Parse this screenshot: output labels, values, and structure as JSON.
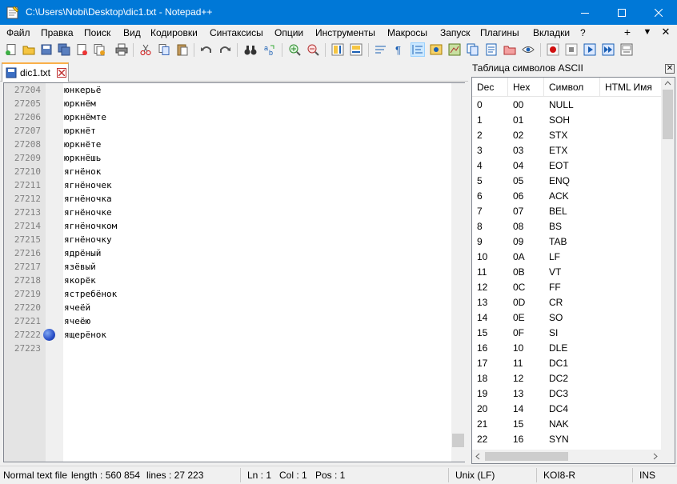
{
  "window": {
    "title": "C:\\Users\\Nobi\\Desktop\\dic1.txt - Notepad++"
  },
  "menu": [
    "Файл",
    "Правка",
    "Поиск",
    "Вид",
    "Кодировки",
    "Синтаксисы",
    "Опции",
    "Инструменты",
    "Макросы",
    "Запуск",
    "Плагины",
    "Вкладки",
    "?"
  ],
  "menu_right": [
    "+",
    "▼",
    "✕"
  ],
  "tab": {
    "label": "dic1.txt"
  },
  "editor": {
    "lines": [
      {
        "num": "27204",
        "text": "юнкерьё"
      },
      {
        "num": "27205",
        "text": "юркнём"
      },
      {
        "num": "27206",
        "text": "юркнёмте"
      },
      {
        "num": "27207",
        "text": "юркнёт"
      },
      {
        "num": "27208",
        "text": "юркнёте"
      },
      {
        "num": "27209",
        "text": "юркнёшь"
      },
      {
        "num": "27210",
        "text": "ягнёнок"
      },
      {
        "num": "27211",
        "text": "ягнёночек"
      },
      {
        "num": "27212",
        "text": "ягнёночка"
      },
      {
        "num": "27213",
        "text": "ягнёночке"
      },
      {
        "num": "27214",
        "text": "ягнёночком"
      },
      {
        "num": "27215",
        "text": "ягнёночку"
      },
      {
        "num": "27216",
        "text": "ядрёный"
      },
      {
        "num": "27217",
        "text": "язёвый"
      },
      {
        "num": "27218",
        "text": "якорёк"
      },
      {
        "num": "27219",
        "text": "ястребёнок"
      },
      {
        "num": "27220",
        "text": "ячеёй"
      },
      {
        "num": "27221",
        "text": "ячеёю"
      },
      {
        "num": "27222",
        "text": "ящерёнок"
      },
      {
        "num": "27223",
        "text": ""
      }
    ],
    "bookmark_line": "27222"
  },
  "ascii_panel": {
    "title": "Таблица символов ASCII",
    "columns": [
      "Dec",
      "Hex",
      "Символ",
      "HTML Имя"
    ],
    "rows": [
      [
        "0",
        "00",
        "NULL"
      ],
      [
        "1",
        "01",
        "SOH"
      ],
      [
        "2",
        "02",
        "STX"
      ],
      [
        "3",
        "03",
        "ETX"
      ],
      [
        "4",
        "04",
        "EOT"
      ],
      [
        "5",
        "05",
        "ENQ"
      ],
      [
        "6",
        "06",
        "ACK"
      ],
      [
        "7",
        "07",
        "BEL"
      ],
      [
        "8",
        "08",
        "BS"
      ],
      [
        "9",
        "09",
        "TAB"
      ],
      [
        "10",
        "0A",
        "LF"
      ],
      [
        "11",
        "0B",
        "VT"
      ],
      [
        "12",
        "0C",
        "FF"
      ],
      [
        "13",
        "0D",
        "CR"
      ],
      [
        "14",
        "0E",
        "SO"
      ],
      [
        "15",
        "0F",
        "SI"
      ],
      [
        "16",
        "10",
        "DLE"
      ],
      [
        "17",
        "11",
        "DC1"
      ],
      [
        "18",
        "12",
        "DC2"
      ],
      [
        "19",
        "13",
        "DC3"
      ],
      [
        "20",
        "14",
        "DC4"
      ],
      [
        "21",
        "15",
        "NAK"
      ],
      [
        "22",
        "16",
        "SYN"
      ]
    ]
  },
  "status": {
    "file_type": "Normal text file",
    "length": "length : 560 854",
    "lines": "lines : 27 223",
    "ln": "Ln : 1",
    "col": "Col : 1",
    "pos": "Pos : 1",
    "eol": "Unix (LF)",
    "encoding": "KOI8-R",
    "mode": "INS"
  },
  "colors": {
    "titlebar": "#0078d7",
    "tab_accent": "#fab04a",
    "gutter": "#e4e4e4"
  }
}
